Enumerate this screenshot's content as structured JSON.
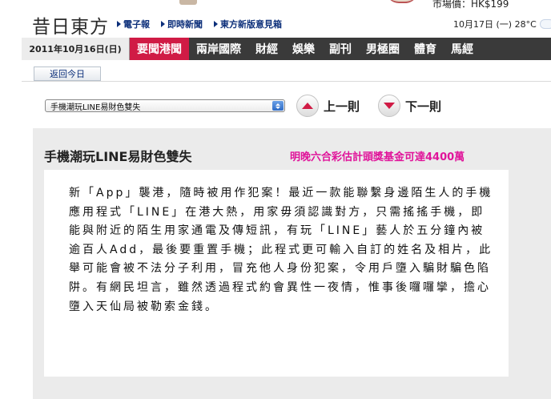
{
  "header": {
    "logo_part1": "昔日",
    "logo_part2": "東方",
    "links": [
      {
        "label": "電子報"
      },
      {
        "label": "即時新聞"
      },
      {
        "label": "東方新版意見箱"
      }
    ],
    "stock": "市場價：HK$199",
    "weather": "10月17日 (一) 28°C"
  },
  "nav": {
    "date": "2011年10月16日(日)",
    "items": [
      {
        "label": "要聞港聞",
        "active": true
      },
      {
        "label": "兩岸國際"
      },
      {
        "label": "財經"
      },
      {
        "label": "娛樂"
      },
      {
        "label": "副刊"
      },
      {
        "label": "男極圈"
      },
      {
        "label": "體育"
      },
      {
        "label": "馬經"
      }
    ]
  },
  "back_today": "返回今日",
  "article_select": {
    "selected": "手機潮玩LINE易財色雙失"
  },
  "pager": {
    "prev_label": "上一則",
    "next_label": "下一則"
  },
  "article": {
    "headline": "手機潮玩LINE易財色雙失",
    "promo": "明晚六合彩估計頭獎基金可達4400萬",
    "body": "新「App」襲港，隨時被用作犯案！最近一款能聯繫身邊陌生人的手機應用程式「LINE」在港大熱，用家毋須認識對方，只需搖搖手機，即能與附近的陌生用家通電及傳短訊，有玩「LINE」藝人於五分鐘內被逾百人Add，最後要重置手機；此程式更可輸入自訂的姓名及相片，此舉可能會被不法分子利用，冒充他人身份犯案，令用戶墮入騙財騙色陷阱。有網民坦言，雖然透過程式約會異性一夜情，惟事後囉囉攣，擔心墮入天仙局被勒索金錢。"
  },
  "colors": {
    "accent": "#d01b45",
    "promo": "#e0149a",
    "nav_bg": "#3a3a3a",
    "link": "#0c2f7a"
  }
}
